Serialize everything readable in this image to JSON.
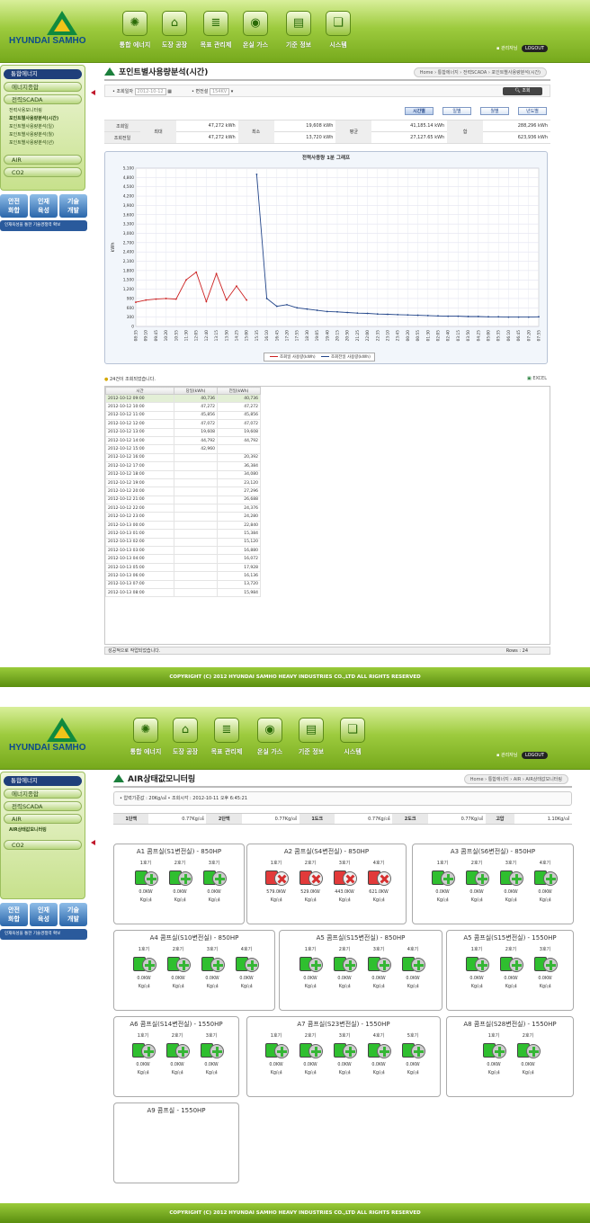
{
  "header": {
    "logo_text": "HYUNDAI SAMHO",
    "nav": [
      {
        "label": "통합 에너지",
        "icon": "atom-icon"
      },
      {
        "label": "도장 공장",
        "icon": "house-icon"
      },
      {
        "label": "목표 관리제",
        "icon": "chart-board-icon"
      },
      {
        "label": "온실 가스",
        "icon": "globe-search-icon"
      },
      {
        "label": "기준 정보",
        "icon": "certificate-icon"
      },
      {
        "label": "시스템",
        "icon": "documents-icon"
      }
    ],
    "user_text": "관리자님",
    "logout_label": "LOGOUT"
  },
  "footer_text": "COPYRIGHT (C) 2012 HYUNDAI SAMHO HEAVY INDUSTRIES CO.,LTD ALL RIGHTS RESERVED",
  "screen1": {
    "sidebar": {
      "main_label": "통합에너지",
      "items": [
        "에너지종합",
        "전력SCADA"
      ],
      "subitems": [
        "전력사용모니터링",
        "포인트별사용량분석(시간)",
        "포인트별사용량분석(일)",
        "포인트별사용량분석(월)",
        "포인트별사용량분석(년)"
      ],
      "extra": [
        "AIR",
        "CO2"
      ],
      "banners": [
        "안전\n화합",
        "인재\n육성",
        "기술\n개발"
      ],
      "banner_long": "인재육성을 통한 기술경쟁력 확보"
    },
    "title": "포인트별사용량분석(시간)",
    "breadcrumb": "Home › 통합에너지 › 전력SCADA › 포인트별사용량분석(시간)",
    "search": {
      "date_label": "• 조회일자",
      "date_value": "2012-10-12",
      "sub_label": "• 변전설",
      "sub_value": "154KV",
      "button": "조회"
    },
    "tabs": [
      "시간별",
      "일별",
      "월별",
      "년도별"
    ],
    "stats": {
      "rows": [
        {
          "label": "조회일",
          "max": "47,272",
          "min": "19,608",
          "avg": "41,185.14",
          "sum": "288,296"
        },
        {
          "label": "조회전일",
          "max": "47,272",
          "min": "13,720",
          "avg": "27,127.65",
          "sum": "623,936"
        }
      ],
      "max_label": "최대",
      "min_label": "최소",
      "avg_label": "평균",
      "sum_label": "합",
      "unit": "kWh"
    },
    "grid_note": "24건이 조회되었습니다.",
    "excel_label": "EXCEL",
    "grid_headers": [
      "시간",
      "당일(kWh)",
      "전일(kWh)"
    ],
    "grid_rows": [
      [
        "2012-10-12 09:00",
        "40,736",
        "40,736"
      ],
      [
        "2012-10-12 10:00",
        "47,272",
        "47,272"
      ],
      [
        "2012-10-12 11:00",
        "45,856",
        "45,856"
      ],
      [
        "2012-10-12 12:00",
        "47,072",
        "47,072"
      ],
      [
        "2012-10-12 13:00",
        "19,608",
        "19,608"
      ],
      [
        "2012-10-12 14:00",
        "44,792",
        "44,792"
      ],
      [
        "2012-10-12 15:00",
        "42,960",
        ""
      ],
      [
        "2012-10-12 16:00",
        "",
        "20,392"
      ],
      [
        "2012-10-12 17:00",
        "",
        "36,384"
      ],
      [
        "2012-10-12 18:00",
        "",
        "34,080"
      ],
      [
        "2012-10-12 19:00",
        "",
        "23,120"
      ],
      [
        "2012-10-12 20:00",
        "",
        "27,296"
      ],
      [
        "2012-10-12 21:00",
        "",
        "26,688"
      ],
      [
        "2012-10-12 22:00",
        "",
        "24,376"
      ],
      [
        "2012-10-12 23:00",
        "",
        "24,280"
      ],
      [
        "2012-10-13 00:00",
        "",
        "22,840"
      ],
      [
        "2012-10-13 01:00",
        "",
        "15,384"
      ],
      [
        "2012-10-13 02:00",
        "",
        "15,120"
      ],
      [
        "2012-10-13 03:00",
        "",
        "16,880"
      ],
      [
        "2012-10-13 04:00",
        "",
        "16,072"
      ],
      [
        "2012-10-13 05:00",
        "",
        "17,928"
      ],
      [
        "2012-10-13 06:00",
        "",
        "16,136"
      ],
      [
        "2012-10-13 07:00",
        "",
        "13,720"
      ],
      [
        "2012-10-13 08:00",
        "",
        "15,984"
      ]
    ],
    "grid_status": "성공적으로 작업되었습니다.",
    "grid_rows_label": "Rows : 24"
  },
  "chart_data": {
    "type": "line",
    "title": "전력사용량 1분 그래프",
    "ylabel": "kWh",
    "ylim": [
      0,
      5100
    ],
    "yticks": [
      0,
      300,
      600,
      900,
      1200,
      1500,
      1800,
      2100,
      2400,
      2700,
      3000,
      3300,
      3600,
      3900,
      4200,
      4500,
      4800,
      5100
    ],
    "categories": [
      "08:35",
      "09:10",
      "09:45",
      "10:20",
      "10:55",
      "11:30",
      "12:05",
      "12:40",
      "13:15",
      "13:50",
      "14:25",
      "15:00",
      "15:35",
      "16:10",
      "16:45",
      "17:20",
      "17:55",
      "18:30",
      "19:05",
      "19:40",
      "20:15",
      "20:50",
      "21:25",
      "22:00",
      "22:35",
      "23:10",
      "23:45",
      "00:20",
      "00:55",
      "01:30",
      "02:05",
      "02:40",
      "03:15",
      "03:50",
      "04:25",
      "05:00",
      "05:35",
      "06:10",
      "06:45",
      "07:20",
      "07:55"
    ],
    "series": [
      {
        "name": "조회일 사용량(kWh)",
        "color": "#cc2222",
        "values": [
          780,
          850,
          880,
          900,
          880,
          1500,
          1750,
          800,
          1700,
          850,
          1300,
          850,
          null,
          null,
          null,
          null,
          null,
          null,
          null,
          null,
          null,
          null,
          null,
          null,
          null,
          null,
          null,
          null,
          null,
          null,
          null,
          null,
          null,
          null,
          null,
          null,
          null,
          null,
          null,
          null,
          null
        ]
      },
      {
        "name": "조회전일 사용량(kWh)",
        "color": "#23468a",
        "values": [
          null,
          null,
          null,
          null,
          null,
          null,
          null,
          null,
          null,
          null,
          null,
          null,
          4900,
          900,
          650,
          700,
          600,
          560,
          520,
          480,
          470,
          450,
          430,
          420,
          400,
          390,
          380,
          370,
          360,
          350,
          340,
          330,
          330,
          320,
          320,
          310,
          310,
          300,
          300,
          300,
          310
        ]
      }
    ]
  },
  "screen2": {
    "sidebar": {
      "main_label": "통합에너지",
      "items": [
        "에너지종합",
        "전력SCADA",
        "AIR"
      ],
      "subitems": [
        "AIR상태값모니터링"
      ],
      "extra": [
        "CO2"
      ],
      "banners": [
        "안전\n화합",
        "인재\n육성",
        "기술\n개발"
      ],
      "banner_long": "인재육성을 통한 기술경쟁력 확보"
    },
    "title": "AIR상태값모니터링",
    "breadcrumb": "Home › 통합에너지 › AIR › AIR상태값모니터링",
    "condition": "• 압력기준값 : 20Kg/㎠   • 조회시각 : 2012-10-11 오후 6:45:21",
    "summary": [
      {
        "k": "1단백",
        "v": "0.77Kg/㎠"
      },
      {
        "k": "2단백",
        "v": "0.77Kg/㎠"
      },
      {
        "k": "1도크",
        "v": "0.77Kg/㎠"
      },
      {
        "k": "2도크",
        "v": "0.77Kg/㎠"
      },
      {
        "k": "고압",
        "v": "1.10Kg/㎠"
      }
    ],
    "rooms": [
      {
        "title": "A1 콤프실(S1변전실) - 850HP",
        "comps": [
          {
            "n": "1호기",
            "s": "ok",
            "v": "0.0KW"
          },
          {
            "n": "2호기",
            "s": "ok",
            "v": "0.0KW"
          },
          {
            "n": "3호기",
            "s": "ok",
            "v": "0.0KW"
          }
        ]
      },
      {
        "title": "A2 콤프실(S4변전실) - 850HP",
        "comps": [
          {
            "n": "1호기",
            "s": "bad",
            "v": "579.0KW"
          },
          {
            "n": "2호기",
            "s": "bad",
            "v": "529.0KW"
          },
          {
            "n": "3호기",
            "s": "bad",
            "v": "443.0KW"
          },
          {
            "n": "4호기",
            "s": "bad",
            "v": "621.0KW"
          }
        ]
      },
      {
        "title": "A3 콤프실(S6변전실) - 850HP",
        "comps": [
          {
            "n": "1호기",
            "s": "ok",
            "v": "0.0KW"
          },
          {
            "n": "2호기",
            "s": "ok",
            "v": "0.0KW"
          },
          {
            "n": "3호기",
            "s": "ok",
            "v": "0.0KW"
          },
          {
            "n": "4호기",
            "s": "ok",
            "v": "0.0KW"
          }
        ]
      },
      {
        "title": "A4 콤프실(S10변전실) - 850HP",
        "comps": [
          {
            "n": "1호기",
            "s": "ok",
            "v": "0.0KW"
          },
          {
            "n": "2호기",
            "s": "ok",
            "v": "0.0KW"
          },
          {
            "n": "3호기",
            "s": "ok",
            "v": "0.0KW"
          },
          {
            "n": "4호기",
            "s": "ok",
            "v": "0.0KW"
          }
        ]
      },
      {
        "title": "A5 콤프실(S15변전실) - 850HP",
        "comps": [
          {
            "n": "1호기",
            "s": "ok",
            "v": "0.0KW"
          },
          {
            "n": "2호기",
            "s": "ok",
            "v": "0.0KW"
          },
          {
            "n": "3호기",
            "s": "ok",
            "v": "0.0KW"
          },
          {
            "n": "4호기",
            "s": "ok",
            "v": "0.0KW"
          }
        ]
      },
      {
        "title": "A5 콤프실(S15변전실) - 1550HP",
        "comps": [
          {
            "n": "1호기",
            "s": "ok",
            "v": "0.0KW"
          },
          {
            "n": "2호기",
            "s": "ok",
            "v": "0.0KW"
          },
          {
            "n": "3호기",
            "s": "ok",
            "v": "0.0KW"
          }
        ]
      },
      {
        "title": "A6 콤프실(S14변전실) - 1550HP",
        "comps": [
          {
            "n": "1호기",
            "s": "ok",
            "v": "0.0KW"
          },
          {
            "n": "2호기",
            "s": "ok",
            "v": "0.0KW"
          },
          {
            "n": "3호기",
            "s": "ok",
            "v": "0.0KW"
          }
        ]
      },
      {
        "title": "A7 콤프실(S23변전실) - 1550HP",
        "comps": [
          {
            "n": "1호기",
            "s": "ok",
            "v": "0.0KW"
          },
          {
            "n": "2호기",
            "s": "ok",
            "v": "0.0KW"
          },
          {
            "n": "3호기",
            "s": "ok",
            "v": "0.0KW"
          },
          {
            "n": "4호기",
            "s": "ok",
            "v": "0.0KW"
          },
          {
            "n": "5호기",
            "s": "ok",
            "v": "0.0KW"
          }
        ]
      },
      {
        "title": "A8 콤프실(S28변전실) - 1550HP",
        "comps": [
          {
            "n": "1호기",
            "s": "ok",
            "v": "0.0KW"
          },
          {
            "n": "2호기",
            "s": "ok",
            "v": "0.0KW"
          }
        ]
      },
      {
        "title": "A9 콤프실 - 1550HP",
        "comps": []
      }
    ],
    "comp_unit": "Kg/㎠"
  }
}
